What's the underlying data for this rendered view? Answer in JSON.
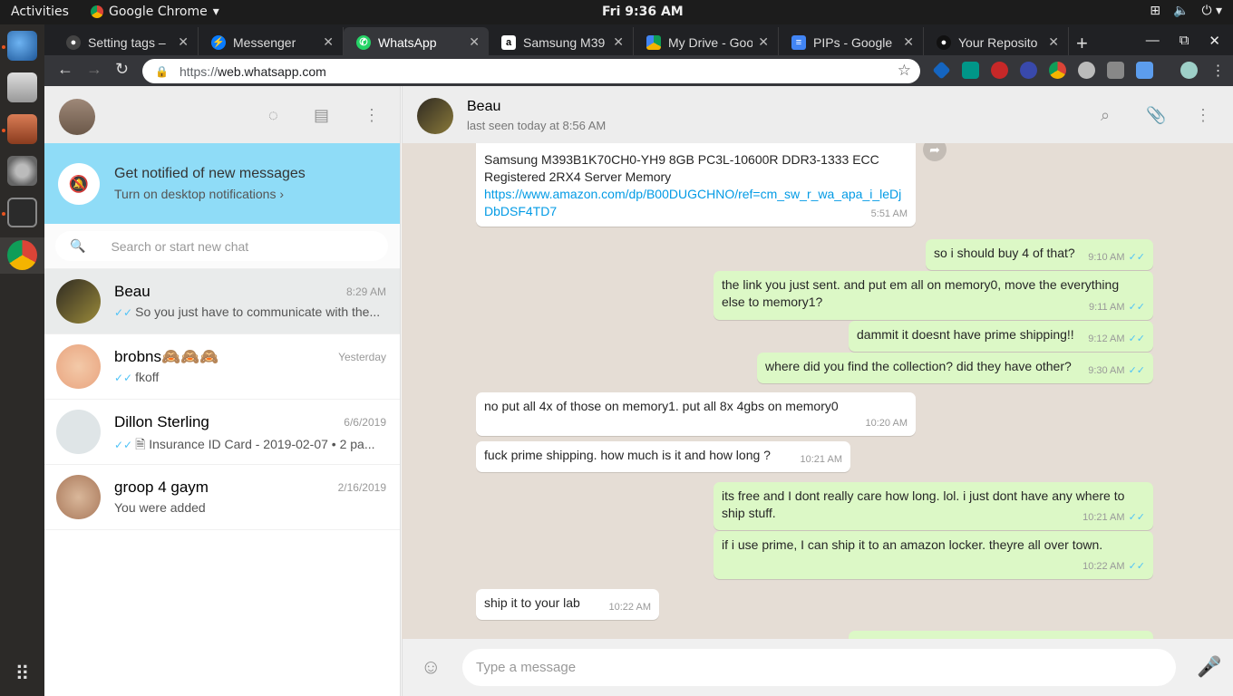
{
  "os_bar": {
    "activities": "Activities",
    "app_name": "Google Chrome",
    "clock": "Fri  9:36 AM"
  },
  "browser": {
    "tabs": [
      {
        "title": "Setting tags –",
        "active": false
      },
      {
        "title": "Messenger",
        "active": false
      },
      {
        "title": "WhatsApp",
        "active": true
      },
      {
        "title": "Samsung M39",
        "active": false
      },
      {
        "title": "My Drive - Goo",
        "active": false
      },
      {
        "title": "PIPs - Google",
        "active": false
      },
      {
        "title": "Your Reposito",
        "active": false
      }
    ],
    "url_scheme": "https://",
    "url_host": "web.whatsapp.com"
  },
  "sidebar": {
    "notification": {
      "title": "Get notified of new messages",
      "subtitle": "Turn on desktop notifications ›"
    },
    "search_placeholder": "Search or start new chat",
    "chats": [
      {
        "name": "Beau",
        "time": "8:29 AM",
        "ticks": "✓✓",
        "preview": "So you just have to communicate with the...",
        "active": true
      },
      {
        "name": "brobns🙈🙈🙈",
        "time": "Yesterday",
        "ticks": "✓✓",
        "preview": "fkoff",
        "active": false
      },
      {
        "name": "Dillon Sterling",
        "time": "6/6/2019",
        "ticks": "✓✓",
        "preview": "🗎 Insurance ID Card - 2019-02-07 • 2 pa...",
        "active": false
      },
      {
        "name": "groop 4 gaym",
        "time": "2/16/2019",
        "ticks": "",
        "preview": "You were added",
        "active": false
      }
    ]
  },
  "conversation": {
    "contact_name": "Beau",
    "contact_status": "last seen today at 8:56 AM",
    "messages": [
      {
        "dir": "in",
        "text": "Samsung M393B1K70CH0-YH9 8GB PC3L-10600R DDR3-1333 ECC Registered  2RX4 Server  Memory",
        "link": "https://www.amazon.com/dp/B00DUGCHNO/ref=cm_sw_r_wa_apa_i_leDjDbDSF4TD7",
        "time": "5:51 AM"
      },
      {
        "dir": "out",
        "text": "so i should buy 4 of that?",
        "time": "9:10 AM"
      },
      {
        "dir": "out",
        "text": "the link you just sent. and put em all on memory0, move the everything else to memory1?",
        "time": "9:11 AM"
      },
      {
        "dir": "out",
        "text": "dammit it doesnt have prime shipping!!",
        "time": "9:12 AM"
      },
      {
        "dir": "out",
        "text": "where did you find the collection? did they have other?",
        "time": "9:30 AM"
      },
      {
        "dir": "in",
        "text": "no put all 4x of those on memory1. put all 8x 4gbs on memory0",
        "time": "10:20 AM"
      },
      {
        "dir": "in",
        "text": "fuck prime shipping. how much is it and how long ?",
        "time": "10:21 AM"
      },
      {
        "dir": "out",
        "text": "its free and I dont really care how long. lol. i just dont have any where to ship stuff.",
        "time": "10:21 AM"
      },
      {
        "dir": "out",
        "text": "if i use prime, I can ship it to an amazon locker. theyre all over town.",
        "time": "10:22 AM"
      },
      {
        "dir": "in",
        "text": "ship it to your lab",
        "time": "10:22 AM"
      }
    ],
    "composer_placeholder": "Type a message"
  },
  "colors": {
    "outgoing_bubble": "#dcf8c6",
    "incoming_bubble": "#ffffff",
    "notification_banner": "#8fdcf7",
    "read_ticks": "#4fc3f7"
  }
}
